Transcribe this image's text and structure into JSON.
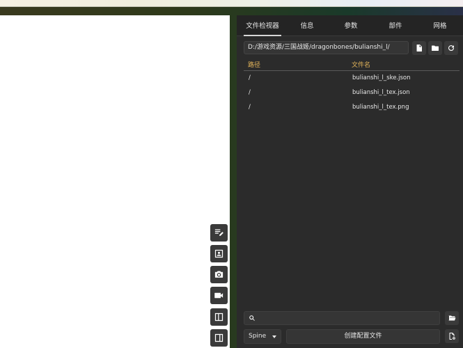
{
  "tabs": [
    {
      "label": "文件检视器"
    },
    {
      "label": "信息"
    },
    {
      "label": "参数"
    },
    {
      "label": "部件"
    },
    {
      "label": "网格"
    }
  ],
  "file_viewer": {
    "path": "D:/游戏资源/三国战姬/dragonbones/bulianshi_l/",
    "columns": {
      "path": "路径",
      "filename": "文件名"
    },
    "rows": [
      {
        "path": "/",
        "filename": "bulianshi_l_ske.json"
      },
      {
        "path": "/",
        "filename": "bulianshi_l_tex.json"
      },
      {
        "path": "/",
        "filename": "bulianshi_l_tex.png"
      }
    ]
  },
  "search": {
    "placeholder": ""
  },
  "format_select": {
    "value": "Spine"
  },
  "create_button": {
    "label": "创建配置文件"
  },
  "icons": {
    "toolbar": [
      "edit-note-icon",
      "portrait-icon",
      "camera-icon",
      "videocam-icon",
      "left-panel-icon",
      "right-panel-icon"
    ],
    "path_actions": [
      "file-icon",
      "folder-icon",
      "refresh-icon"
    ],
    "bottom": [
      "search-icon",
      "folder-open-icon",
      "file-settings-icon"
    ]
  },
  "colors": {
    "panel_bg": "#2b2b2b",
    "header_accent": "#e3b45a",
    "canvas_bg": "#ffffff"
  }
}
